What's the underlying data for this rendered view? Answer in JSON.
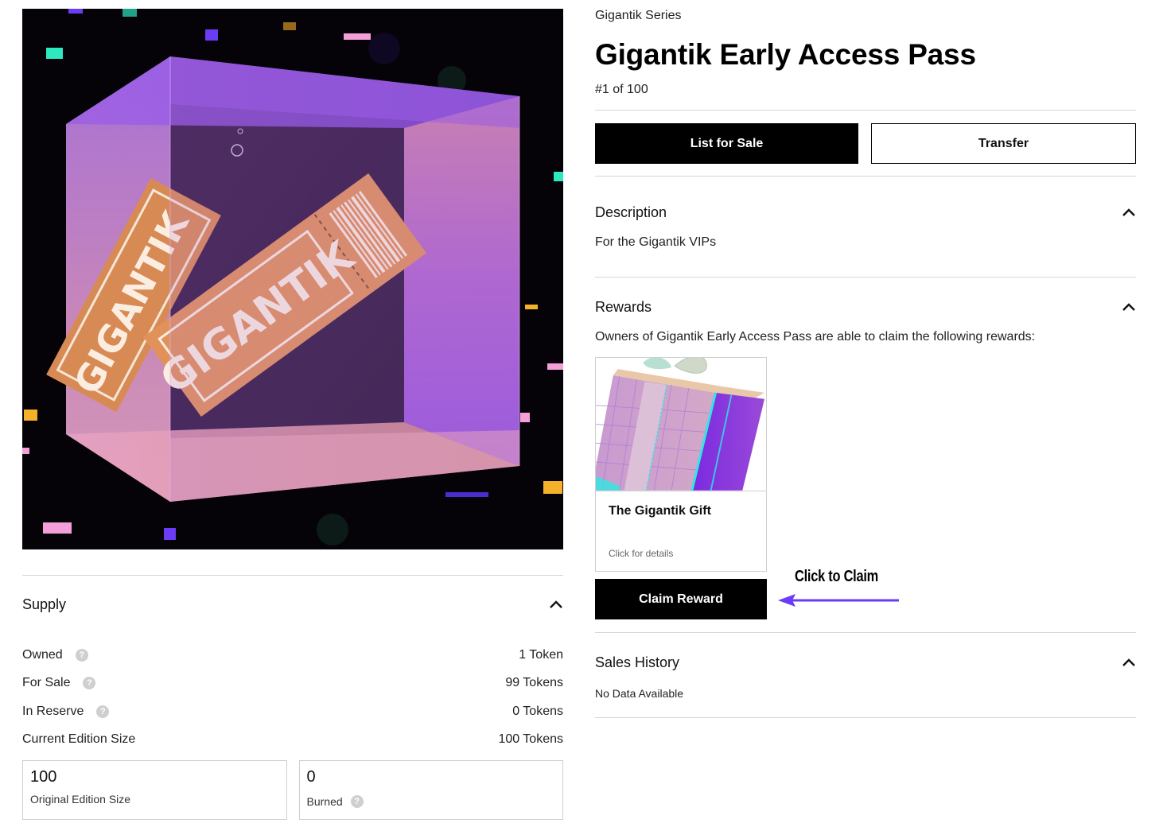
{
  "artwork": {
    "alt": "Gigantik Early Access Pass ticket inside a translucent purple cube",
    "ticket_text": "GIGANTIK",
    "colors": {
      "background": "#050307",
      "cube_purple": "#9b5ce6",
      "ticket_orange": "#e0925a",
      "accent_teal": "#2ee8c0",
      "accent_pink": "#f59fd8",
      "accent_yellow": "#f5b12a",
      "accent_violet": "#6a3cf5"
    }
  },
  "header": {
    "series": "Gigantik Series",
    "title": "Gigantik Early Access Pass",
    "edition": "#1 of 100"
  },
  "actions": {
    "list_for_sale": "List for Sale",
    "transfer": "Transfer"
  },
  "description": {
    "title": "Description",
    "body": "For the Gigantik VIPs",
    "chevron": "chevron-up-icon"
  },
  "rewards": {
    "title": "Rewards",
    "intro": "Owners of Gigantik Early Access Pass are able to claim the following rewards:",
    "items": [
      {
        "name": "The Gigantik Gift",
        "hint": "Click for details",
        "image": "gift-box"
      }
    ],
    "claim_button": "Claim Reward",
    "annotation": "Click to Claim",
    "annotation_color": "#6a3cf5"
  },
  "sales_history": {
    "title": "Sales History",
    "empty": "No Data Available"
  },
  "supply": {
    "title": "Supply",
    "rows": [
      {
        "label": "Owned",
        "value": "1 Token",
        "help": true
      },
      {
        "label": "For Sale",
        "value": "99 Tokens",
        "help": true
      },
      {
        "label": "In Reserve",
        "value": "0 Tokens",
        "help": true
      },
      {
        "label": "Current Edition Size",
        "value": "100 Tokens",
        "help": false
      }
    ],
    "boxes": [
      {
        "number": "100",
        "caption": "Original Edition Size",
        "help": false
      },
      {
        "number": "0",
        "caption": "Burned",
        "help": true
      }
    ]
  },
  "icons": {
    "help": "?"
  }
}
